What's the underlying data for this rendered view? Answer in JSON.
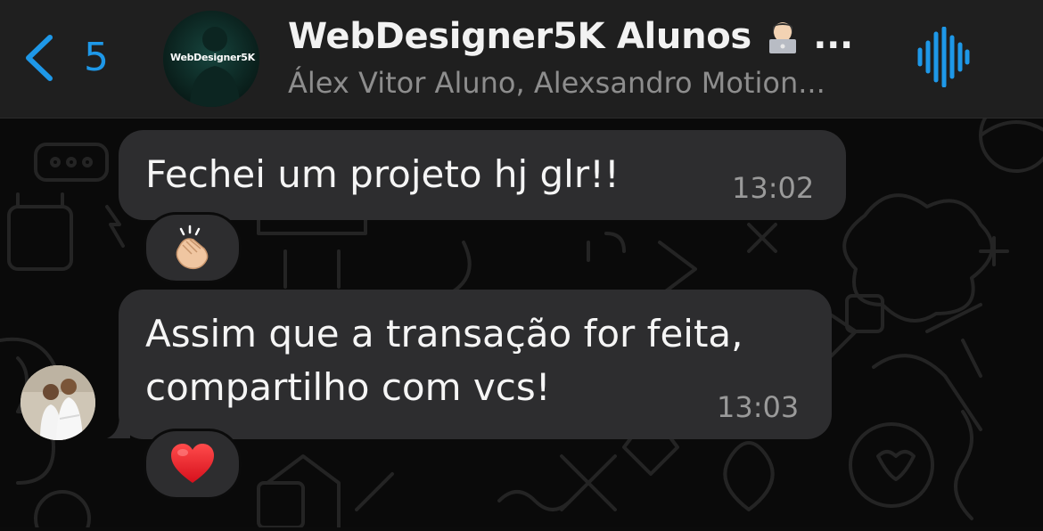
{
  "header": {
    "back_count": "5",
    "title": "WebDesigner5K Alunos",
    "title_emoji": "technologist-emoji",
    "title_ellipsis": "...",
    "subtitle": "Álex Vitor Aluno, Alexsandro Motion...",
    "group_avatar_text": "WebDesigner5K"
  },
  "messages": [
    {
      "text": "Fechei um projeto hj glr!!",
      "time": "13:02",
      "reaction": "clapping-hands-emoji"
    },
    {
      "text": "Assim que a transação for feita, compartilho com vcs!",
      "time": "13:03",
      "reaction": "red-heart-emoji"
    }
  ],
  "colors": {
    "accent": "#1e98e8",
    "header_bg": "#1f1f1f",
    "bubble_bg": "#2d2d2f",
    "chat_bg": "#0a0a0a"
  }
}
